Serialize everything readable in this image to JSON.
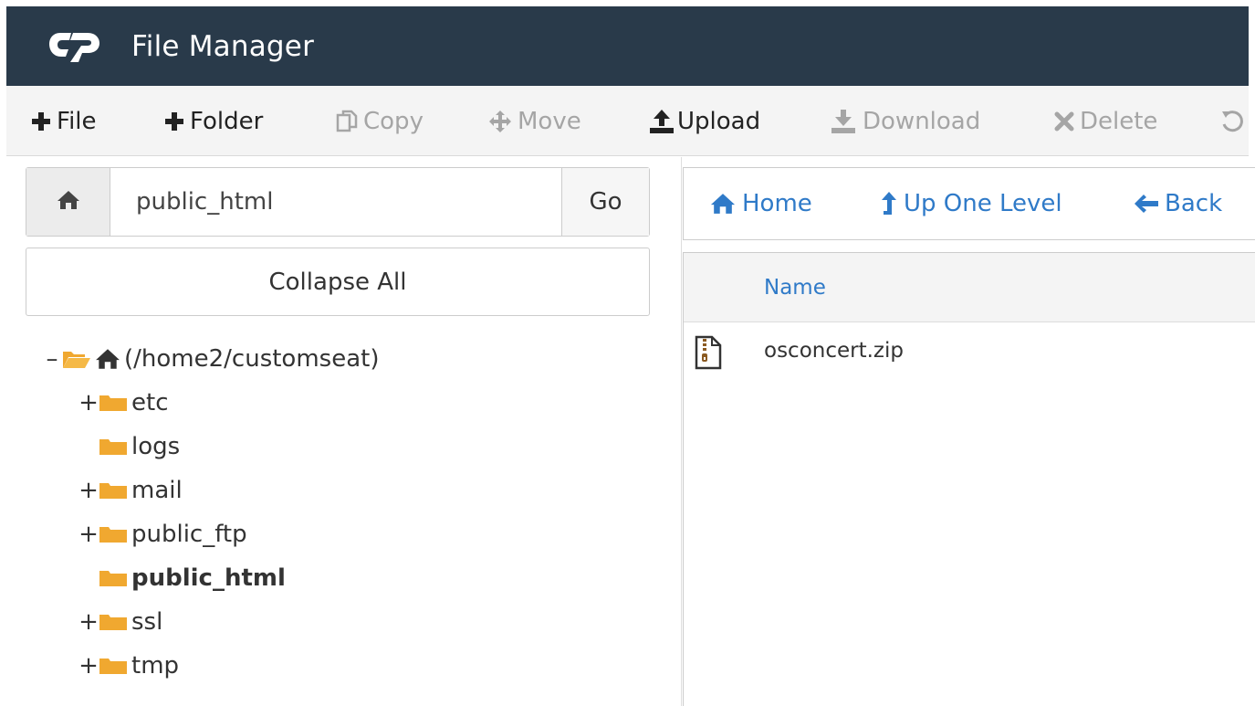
{
  "header": {
    "logo_text": "cP",
    "title": "File Manager"
  },
  "toolbar": {
    "buttons": [
      {
        "label": "File",
        "icon": "plus-icon",
        "enabled": true
      },
      {
        "label": "Folder",
        "icon": "plus-icon",
        "enabled": true
      },
      {
        "label": "Copy",
        "icon": "copy-icon",
        "enabled": false
      },
      {
        "label": "Move",
        "icon": "move-icon",
        "enabled": false
      },
      {
        "label": "Upload",
        "icon": "upload-icon",
        "enabled": true
      },
      {
        "label": "Download",
        "icon": "download-icon",
        "enabled": false
      },
      {
        "label": "Delete",
        "icon": "close-icon",
        "enabled": false
      }
    ]
  },
  "path_bar": {
    "value": "public_html",
    "go_label": "Go"
  },
  "collapse_all_label": "Collapse All",
  "tree": {
    "root": {
      "label": "(/home2/customseat)",
      "toggle": "–"
    },
    "items": [
      {
        "label": "etc",
        "toggle": "+",
        "bold": false
      },
      {
        "label": "logs",
        "toggle": "",
        "bold": false
      },
      {
        "label": "mail",
        "toggle": "+",
        "bold": false
      },
      {
        "label": "public_ftp",
        "toggle": "+",
        "bold": false
      },
      {
        "label": "public_html",
        "toggle": "",
        "bold": true
      },
      {
        "label": "ssl",
        "toggle": "+",
        "bold": false
      },
      {
        "label": "tmp",
        "toggle": "+",
        "bold": false
      }
    ]
  },
  "nav": {
    "home_label": "Home",
    "up_label": "Up One Level",
    "back_label": "Back"
  },
  "file_list": {
    "column_name": "Name",
    "files": [
      {
        "name": "osconcert.zip",
        "icon": "zip-file-icon"
      }
    ]
  },
  "colors": {
    "header_bg": "#293a4a",
    "link_blue": "#2f7ac8",
    "folder_orange": "#f0a830"
  }
}
